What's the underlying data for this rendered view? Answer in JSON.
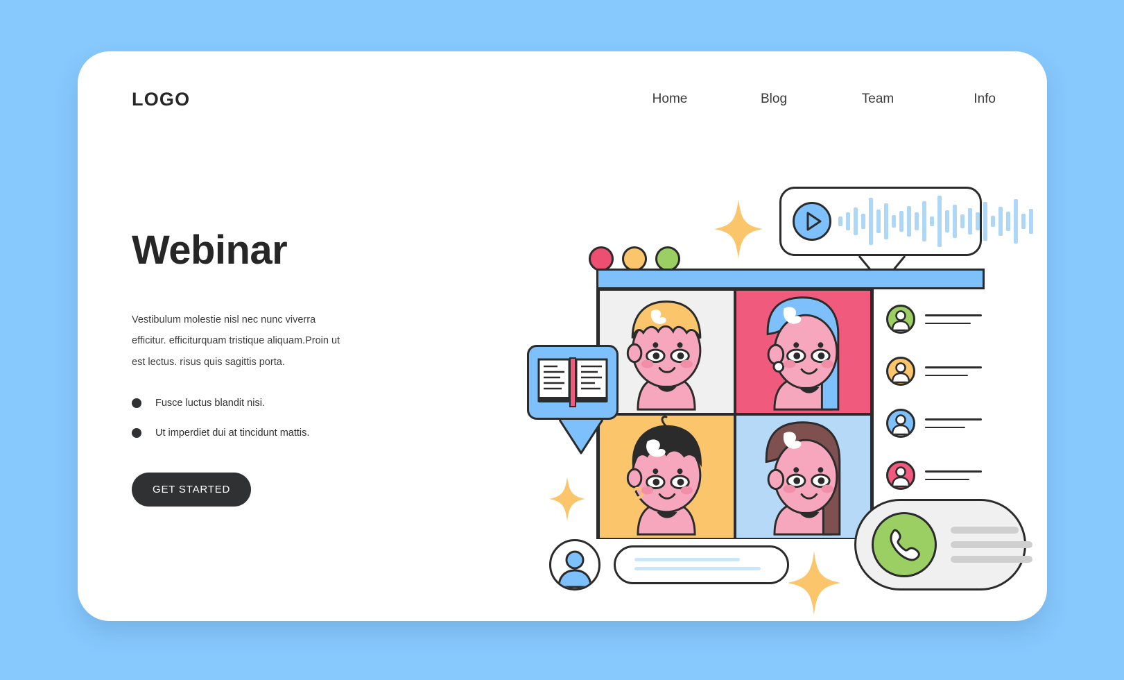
{
  "page": {
    "background_color": "#87c9fd",
    "card_color": "#ffffff"
  },
  "header": {
    "logo": "LOGO",
    "nav": [
      {
        "label": "Home"
      },
      {
        "label": "Blog"
      },
      {
        "label": "Team"
      },
      {
        "label": "Info"
      }
    ]
  },
  "hero": {
    "title": "Webinar",
    "paragraph": "Vestibulum molestie nisl nec nunc viverra efficitur. efficiturquam tristique aliquam.Proin ut est lectus. risus quis sagittis porta.",
    "bullets": [
      {
        "text": "Fusce luctus blandit nisi."
      },
      {
        "text": "Ut imperdiet dui at tincidunt mattis."
      }
    ],
    "cta_label": "GET STARTED"
  },
  "illustration": {
    "window": {
      "title_bar_color": "#7ec0fb",
      "dots": [
        {
          "name": "close-dot",
          "color": "#ed4f72"
        },
        {
          "name": "minimize-dot",
          "color": "#fbc66b"
        },
        {
          "name": "maximize-dot",
          "color": "#9bcf63"
        }
      ],
      "video_tiles": [
        {
          "name": "participant-tile-blonde",
          "background": "#f0f0f0",
          "hair": "#fbc66b",
          "skin": "#f6a6bd"
        },
        {
          "name": "participant-tile-bluehair",
          "background": "#ef5a7d",
          "hair": "#7ec0fb",
          "skin": "#f6a6bd"
        },
        {
          "name": "participant-tile-darkhair",
          "background": "#fbc66b",
          "hair": "#2b2b2b",
          "skin": "#f6a6bd"
        },
        {
          "name": "participant-tile-brownhair",
          "background": "#b6d9f8",
          "hair": "#7e5150",
          "skin": "#f6a6bd"
        }
      ],
      "participant_list": [
        {
          "avatar_color": "#9bcf63"
        },
        {
          "avatar_color": "#fbc66b"
        },
        {
          "avatar_color": "#7ec0fb"
        },
        {
          "avatar_color": "#ef5a7d"
        }
      ]
    },
    "audio_bubble": {
      "play_button_color": "#7ec0fb",
      "wave_color": "#aed6f5",
      "wave_heights": [
        14,
        26,
        40,
        22,
        68,
        34,
        52,
        18,
        30,
        44,
        26,
        58,
        14,
        74,
        32,
        48,
        20,
        38,
        26,
        56,
        16,
        42,
        28,
        64,
        22,
        36
      ]
    },
    "book_bubble": {
      "bubble_color": "#7ec0fb",
      "bookmark_color": "#ef5a7d"
    },
    "chat": {
      "avatar_color": "#7ec0fb",
      "placeholder_line_color": "#cbe5fb"
    },
    "phone_card": {
      "circle_color": "#9bcf63",
      "card_color": "#f0f0f0",
      "line_color": "#cfcfcf"
    },
    "sparkles": [
      {
        "name": "sparkle-top",
        "color": "#fbc66b"
      },
      {
        "name": "sparkle-left",
        "color": "#fbc66b"
      },
      {
        "name": "sparkle-bottom",
        "color": "#fbc66b"
      }
    ]
  }
}
